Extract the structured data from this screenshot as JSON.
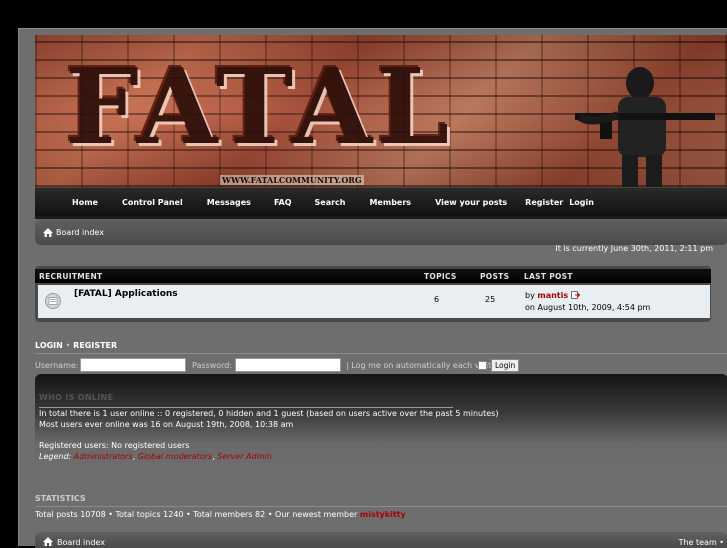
{
  "banner": {
    "logo_text": "FATAL",
    "url_text": "WWW.FATALCOMMUNITY.ORG"
  },
  "nav": [
    "Home",
    "Control Panel",
    "Messages",
    "FAQ",
    "Search",
    "Members",
    "View your posts",
    "Register",
    "Login"
  ],
  "breadcrumb": {
    "label": "Board index"
  },
  "current_time": "It is currently June 30th, 2011, 2:11 pm",
  "forum_table": {
    "headers": {
      "category": "RECRUITMENT",
      "topics": "TOPICS",
      "posts": "POSTS",
      "last_post": "LAST POST"
    },
    "rows": [
      {
        "title": "[FATAL] Applications",
        "topics": "6",
        "posts": "25",
        "by_label": "by",
        "author": "mantis",
        "date": "on August 10th, 2009, 4:54 pm"
      }
    ]
  },
  "login": {
    "title_login": "LOGIN",
    "separator": "•",
    "title_register": "REGISTER",
    "username_label": "Username:",
    "password_label": "Password:",
    "auto_label": "| Log me on automatically each visit",
    "button": "Login"
  },
  "online": {
    "title": "WHO IS ONLINE",
    "line1": "In total there is 1 user online :: 0 registered, 0 hidden and 1 guest (based on users active over the past 5 minutes)",
    "line2": "Most users ever online was 16 on August 19th, 2008, 10:38 am",
    "line3": "Registered users: No registered users",
    "legend_label": "Legend:",
    "groups": [
      "Administrators",
      "Global moderators",
      "Server Admin"
    ]
  },
  "statistics": {
    "title": "STATISTICS",
    "text": "Total posts 10708 • Total topics 1240 • Total members 82 • Our newest member",
    "newest_member": "mistykitty"
  },
  "footer": {
    "breadcrumb": "Board index",
    "team": "The team •"
  },
  "colors": {
    "page_bg": "#6e6e6e",
    "accent_red": "#aa0000",
    "row_bg": "#e9eef2"
  }
}
